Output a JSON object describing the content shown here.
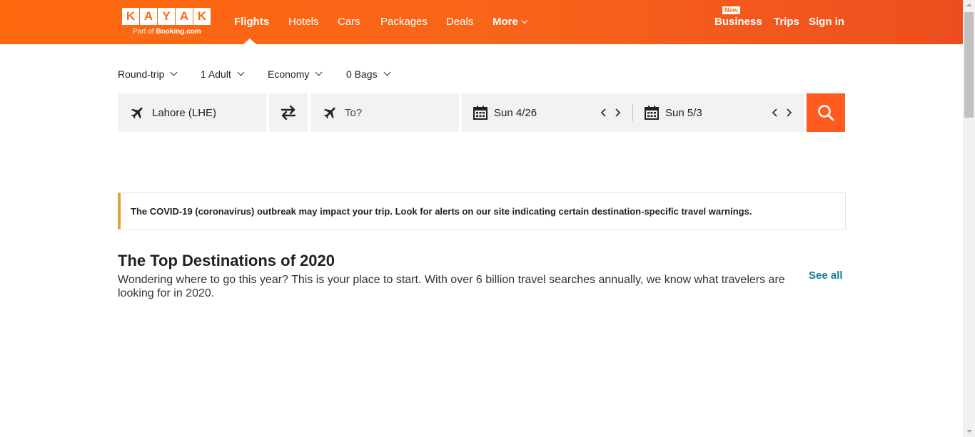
{
  "header": {
    "logo": {
      "letters": [
        "K",
        "A",
        "Y",
        "A",
        "K"
      ],
      "sub_prefix": "Part of ",
      "sub_brand": "Booking.com"
    },
    "nav": [
      {
        "label": "Flights",
        "active": true
      },
      {
        "label": "Hotels"
      },
      {
        "label": "Cars"
      },
      {
        "label": "Packages"
      },
      {
        "label": "Deals"
      },
      {
        "label": "More"
      }
    ],
    "right": {
      "new_badge": "New",
      "business": "Business",
      "trips": "Trips",
      "sign_in": "Sign in"
    }
  },
  "search": {
    "options": {
      "trip_type": "Round-trip",
      "travelers": "1 Adult",
      "cabin": "Economy",
      "bags": "0 Bags"
    },
    "origin": "Lahore (LHE)",
    "destination_placeholder": "To?",
    "depart_date": "Sun 4/26",
    "return_date": "Sun 5/3"
  },
  "alert": {
    "text": "The COVID-19 (coronavirus) outbreak may impact your trip. Look for alerts on our site indicating certain destination-specific travel warnings."
  },
  "top_destinations": {
    "title": "The Top Destinations of 2020",
    "description": "Wondering where to go this year? This is your place to start. With over 6 billion travel searches annually, we know what travelers are looking for in 2020.",
    "see_all": "See all"
  },
  "colors": {
    "brand": "#ff690f",
    "accent_link": "#0d7c9c",
    "alert_border": "#e0a23a",
    "field_bg": "#f1f2f4"
  }
}
